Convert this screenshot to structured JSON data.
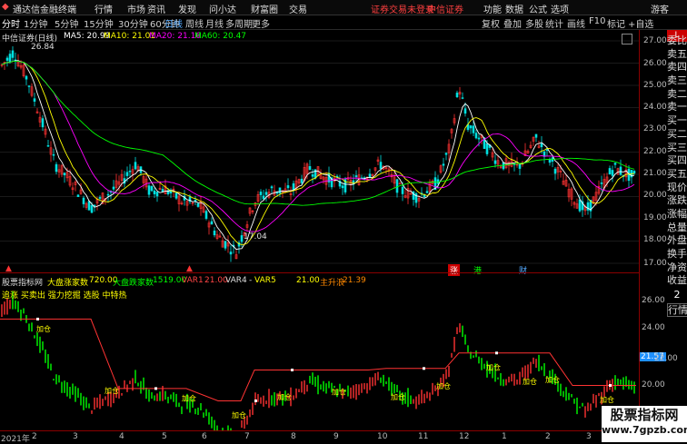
{
  "menubar": {
    "app_title": "通达信金融终端",
    "menus": [
      "行情",
      "市场",
      "资讯",
      "发现",
      "问小达",
      "财富圈",
      "交易"
    ],
    "login_status": "证券交易未登录",
    "broker": "中信证券",
    "right": [
      "功能",
      "数据",
      "公式",
      "选项",
      "游客"
    ]
  },
  "toolbar": {
    "periods": [
      "分时",
      "1分钟",
      "5分钟",
      "15分钟",
      "30分钟",
      "60分钟",
      "日线",
      "周线",
      "月线",
      "多周期",
      "更多"
    ],
    "active": "日线",
    "tools": [
      "复权",
      "叠加",
      "多股",
      "统计",
      "画线",
      "F10",
      "标记",
      "+自选"
    ]
  },
  "legend": {
    "name": "中信证券(日线)",
    "ma5": "MA5: 20.99",
    "ma10": "MA10: 21.01",
    "ma20": "MA20: 21.16",
    "ma60": "MA60: 20.47"
  },
  "colors": {
    "up": "#ff3232",
    "down": "#00e0e0",
    "ma5": "#ffffff",
    "ma10": "#ffff00",
    "ma20": "#ff00ff",
    "ma60": "#00ff00",
    "accent": "#ff3232"
  },
  "main_axis": [
    "27.00",
    "26.00",
    "25.00",
    "24.00",
    "23.00",
    "22.00",
    "21.00",
    "20.00",
    "19.00",
    "18.00",
    "17.00"
  ],
  "price_marks": {
    "high": "26.84",
    "low": "17.04"
  },
  "event_markers": [
    "涨",
    "港",
    "财"
  ],
  "indicator": {
    "title": "股票指标网",
    "line1": [
      {
        "k": "大盘涨家数",
        "v": "720.00"
      },
      {
        "k": "大盘跌家数",
        "v": "1519.00"
      },
      {
        "k": "VAR1",
        "v": "21.00"
      },
      {
        "k": "VAR4",
        "v": "-"
      },
      {
        "k": "VAR5",
        "v": "21.00"
      },
      {
        "k": "主升浪",
        "v": "21.39"
      }
    ],
    "line2": "追涨 买卖出 强力挖掘 选股 中特热",
    "axis": [
      "26.00",
      "24.00",
      "22.00",
      "20.00"
    ],
    "current": "21.57",
    "tag": "加仓"
  },
  "xaxis": [
    "2021年",
    "2",
    "3",
    "4",
    "5",
    "6",
    "7",
    "8",
    "9",
    "10",
    "11",
    "12",
    "1",
    "2",
    "3"
  ],
  "side_panel": [
    "委比",
    "卖五",
    "卖四",
    "卖三",
    "卖二",
    "卖一",
    "买一",
    "买二",
    "买三",
    "买四",
    "买五",
    "现价",
    "涨跌",
    "涨幅",
    "总量",
    "外盘",
    "换手",
    "净资",
    "收益"
  ],
  "side_tabs": [
    "L",
    "2",
    "行情"
  ],
  "watermark": {
    "title": "股票指标网",
    "url": "www.7gpzb.com"
  }
}
